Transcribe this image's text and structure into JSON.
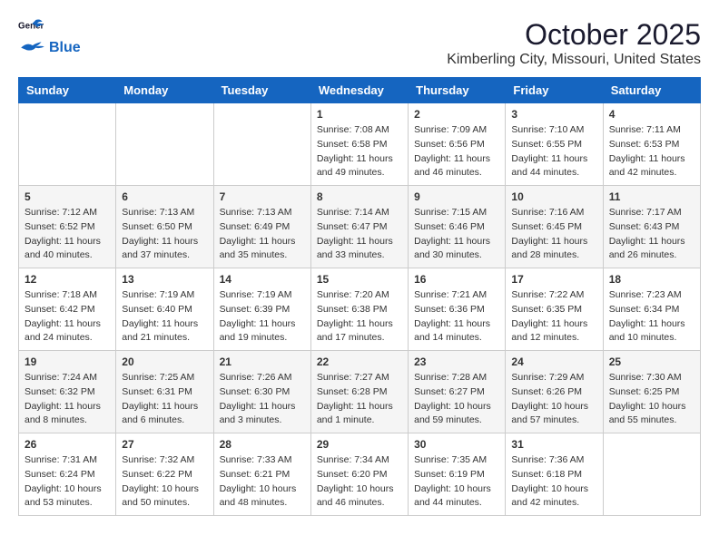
{
  "header": {
    "logo_general": "General",
    "logo_blue": "Blue",
    "month_title": "October 2025",
    "location": "Kimberling City, Missouri, United States"
  },
  "days_of_week": [
    "Sunday",
    "Monday",
    "Tuesday",
    "Wednesday",
    "Thursday",
    "Friday",
    "Saturday"
  ],
  "weeks": [
    [
      {
        "day": "",
        "info": ""
      },
      {
        "day": "",
        "info": ""
      },
      {
        "day": "",
        "info": ""
      },
      {
        "day": "1",
        "info": "Sunrise: 7:08 AM\nSunset: 6:58 PM\nDaylight: 11 hours\nand 49 minutes."
      },
      {
        "day": "2",
        "info": "Sunrise: 7:09 AM\nSunset: 6:56 PM\nDaylight: 11 hours\nand 46 minutes."
      },
      {
        "day": "3",
        "info": "Sunrise: 7:10 AM\nSunset: 6:55 PM\nDaylight: 11 hours\nand 44 minutes."
      },
      {
        "day": "4",
        "info": "Sunrise: 7:11 AM\nSunset: 6:53 PM\nDaylight: 11 hours\nand 42 minutes."
      }
    ],
    [
      {
        "day": "5",
        "info": "Sunrise: 7:12 AM\nSunset: 6:52 PM\nDaylight: 11 hours\nand 40 minutes."
      },
      {
        "day": "6",
        "info": "Sunrise: 7:13 AM\nSunset: 6:50 PM\nDaylight: 11 hours\nand 37 minutes."
      },
      {
        "day": "7",
        "info": "Sunrise: 7:13 AM\nSunset: 6:49 PM\nDaylight: 11 hours\nand 35 minutes."
      },
      {
        "day": "8",
        "info": "Sunrise: 7:14 AM\nSunset: 6:47 PM\nDaylight: 11 hours\nand 33 minutes."
      },
      {
        "day": "9",
        "info": "Sunrise: 7:15 AM\nSunset: 6:46 PM\nDaylight: 11 hours\nand 30 minutes."
      },
      {
        "day": "10",
        "info": "Sunrise: 7:16 AM\nSunset: 6:45 PM\nDaylight: 11 hours\nand 28 minutes."
      },
      {
        "day": "11",
        "info": "Sunrise: 7:17 AM\nSunset: 6:43 PM\nDaylight: 11 hours\nand 26 minutes."
      }
    ],
    [
      {
        "day": "12",
        "info": "Sunrise: 7:18 AM\nSunset: 6:42 PM\nDaylight: 11 hours\nand 24 minutes."
      },
      {
        "day": "13",
        "info": "Sunrise: 7:19 AM\nSunset: 6:40 PM\nDaylight: 11 hours\nand 21 minutes."
      },
      {
        "day": "14",
        "info": "Sunrise: 7:19 AM\nSunset: 6:39 PM\nDaylight: 11 hours\nand 19 minutes."
      },
      {
        "day": "15",
        "info": "Sunrise: 7:20 AM\nSunset: 6:38 PM\nDaylight: 11 hours\nand 17 minutes."
      },
      {
        "day": "16",
        "info": "Sunrise: 7:21 AM\nSunset: 6:36 PM\nDaylight: 11 hours\nand 14 minutes."
      },
      {
        "day": "17",
        "info": "Sunrise: 7:22 AM\nSunset: 6:35 PM\nDaylight: 11 hours\nand 12 minutes."
      },
      {
        "day": "18",
        "info": "Sunrise: 7:23 AM\nSunset: 6:34 PM\nDaylight: 11 hours\nand 10 minutes."
      }
    ],
    [
      {
        "day": "19",
        "info": "Sunrise: 7:24 AM\nSunset: 6:32 PM\nDaylight: 11 hours\nand 8 minutes."
      },
      {
        "day": "20",
        "info": "Sunrise: 7:25 AM\nSunset: 6:31 PM\nDaylight: 11 hours\nand 6 minutes."
      },
      {
        "day": "21",
        "info": "Sunrise: 7:26 AM\nSunset: 6:30 PM\nDaylight: 11 hours\nand 3 minutes."
      },
      {
        "day": "22",
        "info": "Sunrise: 7:27 AM\nSunset: 6:28 PM\nDaylight: 11 hours\nand 1 minute."
      },
      {
        "day": "23",
        "info": "Sunrise: 7:28 AM\nSunset: 6:27 PM\nDaylight: 10 hours\nand 59 minutes."
      },
      {
        "day": "24",
        "info": "Sunrise: 7:29 AM\nSunset: 6:26 PM\nDaylight: 10 hours\nand 57 minutes."
      },
      {
        "day": "25",
        "info": "Sunrise: 7:30 AM\nSunset: 6:25 PM\nDaylight: 10 hours\nand 55 minutes."
      }
    ],
    [
      {
        "day": "26",
        "info": "Sunrise: 7:31 AM\nSunset: 6:24 PM\nDaylight: 10 hours\nand 53 minutes."
      },
      {
        "day": "27",
        "info": "Sunrise: 7:32 AM\nSunset: 6:22 PM\nDaylight: 10 hours\nand 50 minutes."
      },
      {
        "day": "28",
        "info": "Sunrise: 7:33 AM\nSunset: 6:21 PM\nDaylight: 10 hours\nand 48 minutes."
      },
      {
        "day": "29",
        "info": "Sunrise: 7:34 AM\nSunset: 6:20 PM\nDaylight: 10 hours\nand 46 minutes."
      },
      {
        "day": "30",
        "info": "Sunrise: 7:35 AM\nSunset: 6:19 PM\nDaylight: 10 hours\nand 44 minutes."
      },
      {
        "day": "31",
        "info": "Sunrise: 7:36 AM\nSunset: 6:18 PM\nDaylight: 10 hours\nand 42 minutes."
      },
      {
        "day": "",
        "info": ""
      }
    ]
  ]
}
